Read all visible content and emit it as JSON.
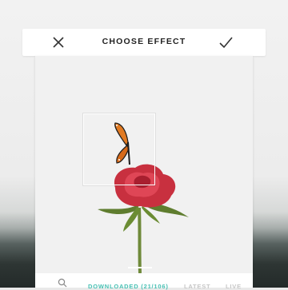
{
  "header": {
    "title": "CHOOSE EFFECT",
    "close_icon": "close-icon",
    "confirm_icon": "checkmark-icon"
  },
  "tabs": [
    {
      "label": "DOWNLOADED (21/106)",
      "active": true
    },
    {
      "label": "LATEST",
      "active": false
    },
    {
      "label": "LIVE",
      "active": false
    }
  ],
  "colors": {
    "accent": "#47c0b3",
    "inactive_tab": "#c6c6c6",
    "rose": "#d43c4c",
    "butterfly": "#e17a22"
  }
}
